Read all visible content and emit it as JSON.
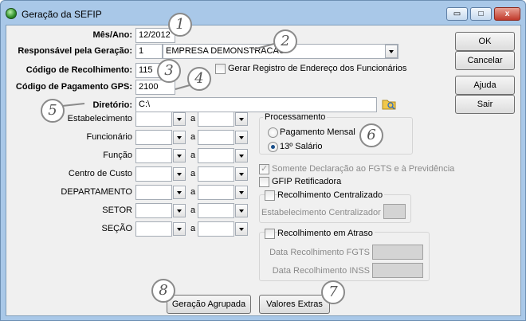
{
  "window": {
    "title": "Geração da SEFIP"
  },
  "titlebar": {
    "min": "▭",
    "max": "□",
    "close": "x"
  },
  "fields": {
    "mes_ano": {
      "label": "Mês/Ano",
      "value": "12/2012"
    },
    "responsavel": {
      "label": "Responsável pela Geração",
      "code": "1",
      "name": "EMPRESA DEMONSTRACAO"
    },
    "codigo_recolhimento": {
      "label": "Código de Recolhimento",
      "value": "115"
    },
    "gerar_registro": {
      "label": "Gerar Registro de Endereço dos Funcionários",
      "checked": false
    },
    "codigo_pagamento": {
      "label": "Código de Pagamento GPS",
      "value": "2100"
    },
    "diretorio": {
      "label": "Diretório",
      "value": "C:\\"
    }
  },
  "ranges": [
    {
      "label": "Estabelecimento",
      "sep": "a"
    },
    {
      "label": "Funcionário",
      "sep": "a"
    },
    {
      "label": "Função",
      "sep": "a"
    },
    {
      "label": "Centro de Custo",
      "sep": "a"
    },
    {
      "label": "DEPARTAMENTO",
      "sep": "a"
    },
    {
      "label": "SETOR",
      "sep": "a"
    },
    {
      "label": "SEÇÃO",
      "sep": "a"
    }
  ],
  "processamento": {
    "title": "Processamento",
    "options": [
      "Pagamento Mensal",
      "13º Salário"
    ],
    "selected": "13º Salário"
  },
  "options": {
    "somente_declaracao": "Somente Declaração ao FGTS e à Previdência",
    "gfip_retificadora": "GFIP Retificadora",
    "recolhimento_centralizado": "Recolhimento Centralizado",
    "estabelecimento_centralizador": "Estabelecimento Centralizador",
    "recolhimento_atraso": "Recolhimento em Atraso",
    "data_fgts": "Data Recolhimento FGTS",
    "data_inss": "Data Recolhimento INSS"
  },
  "buttons": {
    "ok": "OK",
    "cancelar": "Cancelar",
    "ajuda": "Ajuda",
    "sair": "Sair",
    "geracao_agrupada": "Geração Agrupada",
    "valores_extras": "Valores Extras"
  },
  "callouts": [
    "1",
    "2",
    "3",
    "4",
    "5",
    "6",
    "7",
    "8"
  ]
}
